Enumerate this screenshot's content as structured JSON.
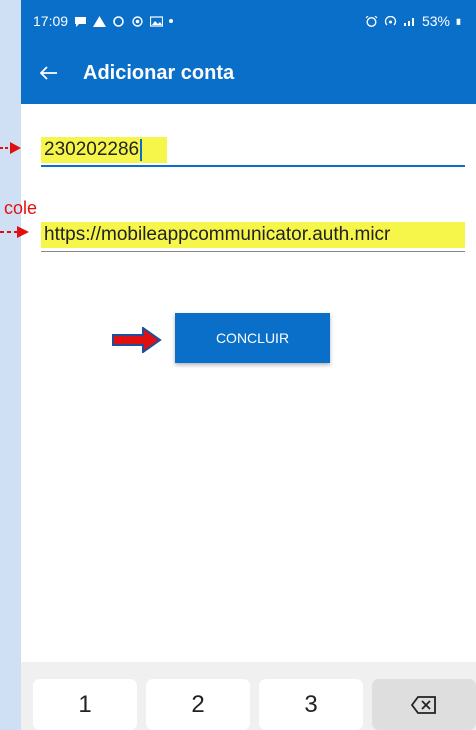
{
  "status_bar": {
    "time": "17:09",
    "battery": "53%"
  },
  "app_bar": {
    "title": "Adicionar conta"
  },
  "form": {
    "account_value": "230202286",
    "url_value": "https://mobileappcommunicator.auth.micr"
  },
  "actions": {
    "concluir_label": "CONCLUIR"
  },
  "annotation": {
    "cole_label": "cole"
  },
  "keyboard": {
    "keys": [
      "1",
      "2",
      "3"
    ]
  },
  "colors": {
    "accent": "#0a6fc9",
    "highlight": "#f6f64a",
    "annotation_red": "#e01010"
  }
}
